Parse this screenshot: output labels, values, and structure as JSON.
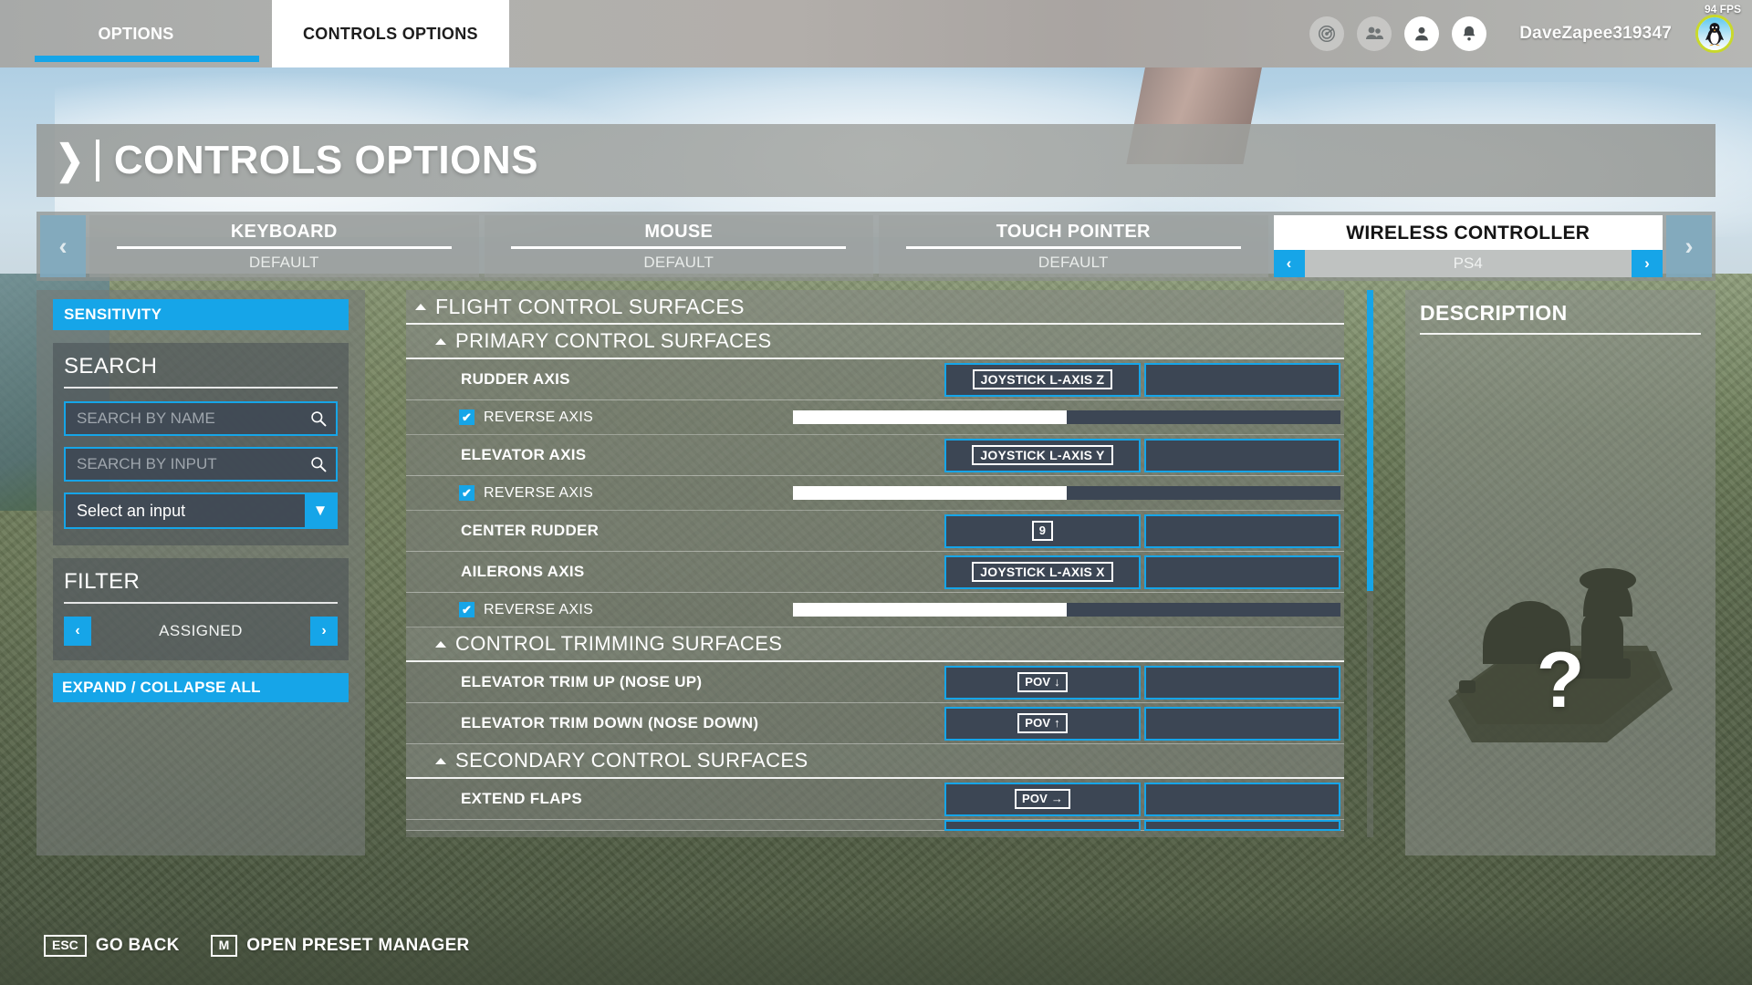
{
  "topbar": {
    "tabs": [
      {
        "label": "OPTIONS",
        "active": false
      },
      {
        "label": "CONTROLS OPTIONS",
        "active": true
      }
    ],
    "icons": [
      "radar-icon",
      "friends-icon",
      "profile-icon",
      "notifications-icon"
    ],
    "username": "DaveZapee319347",
    "avatar_name": "penguin-avatar",
    "fps": "94 FPS"
  },
  "header": {
    "title": "CONTROLS OPTIONS",
    "back_chevron": "❯"
  },
  "devices": {
    "prev_arrow": "‹",
    "next_arrow": "›",
    "items": [
      {
        "name": "KEYBOARD",
        "preset": "DEFAULT",
        "active": false
      },
      {
        "name": "MOUSE",
        "preset": "DEFAULT",
        "active": false
      },
      {
        "name": "TOUCH POINTER",
        "preset": "DEFAULT",
        "active": false
      },
      {
        "name": "WIRELESS CONTROLLER",
        "preset": "PS4",
        "active": true
      }
    ],
    "preset_prev": "‹",
    "preset_next": "›"
  },
  "sidebar": {
    "sensitivity_label": "SENSITIVITY",
    "search_heading": "SEARCH",
    "search_by_name": {
      "value": "",
      "placeholder": "SEARCH BY NAME"
    },
    "search_by_input": {
      "value": "",
      "placeholder": "SEARCH BY INPUT"
    },
    "select_input": {
      "value": "Select an input"
    },
    "filter_heading": "FILTER",
    "filter_value": "ASSIGNED",
    "filter_prev": "‹",
    "filter_next": "›",
    "expand_collapse_label": "EXPAND / COLLAPSE ALL"
  },
  "list": {
    "groups": [
      {
        "label": "FLIGHT CONTROL SURFACES",
        "level": 1
      },
      {
        "label": "PRIMARY CONTROL SURFACES",
        "level": 2
      }
    ],
    "rows": [
      {
        "type": "binding",
        "name": "RUDDER AXIS",
        "primary": "JOYSTICK L-AXIS Z",
        "secondary": ""
      },
      {
        "type": "reverse",
        "label": "REVERSE AXIS",
        "checked": true,
        "fill_pct": 50
      },
      {
        "type": "binding",
        "name": "ELEVATOR AXIS",
        "primary": "JOYSTICK L-AXIS Y",
        "secondary": ""
      },
      {
        "type": "reverse",
        "label": "REVERSE AXIS",
        "checked": true,
        "fill_pct": 50
      },
      {
        "type": "binding",
        "name": "CENTER RUDDER",
        "primary": "9",
        "secondary": "",
        "primary_small": true
      },
      {
        "type": "binding",
        "name": "AILERONS AXIS",
        "primary": "JOYSTICK L-AXIS X",
        "secondary": ""
      },
      {
        "type": "reverse",
        "label": "REVERSE AXIS",
        "checked": true,
        "fill_pct": 50
      },
      {
        "type": "group2",
        "label": "CONTROL TRIMMING SURFACES"
      },
      {
        "type": "binding",
        "name": "ELEVATOR TRIM UP (NOSE UP)",
        "primary": "POV ↓",
        "secondary": "",
        "primary_small": true
      },
      {
        "type": "binding",
        "name": "ELEVATOR TRIM DOWN (NOSE DOWN)",
        "primary": "POV ↑",
        "secondary": "",
        "primary_small": true
      },
      {
        "type": "group2",
        "label": "SECONDARY CONTROL SURFACES"
      },
      {
        "type": "binding",
        "name": "EXTEND FLAPS",
        "primary": "POV →",
        "secondary": "",
        "primary_small": true
      }
    ],
    "checkmark": "✔",
    "scroll_thumb_pct": 55
  },
  "description": {
    "heading": "DESCRIPTION",
    "body": "",
    "placeholder_glyph": "?"
  },
  "footer": {
    "actions": [
      {
        "key": "ESC",
        "label": "GO BACK"
      },
      {
        "key": "M",
        "label": "OPEN PRESET MANAGER"
      }
    ]
  },
  "colors": {
    "accent": "#16a5e8",
    "bind_bg": "#3c4654",
    "avatar_ring": "#c9d92b"
  }
}
